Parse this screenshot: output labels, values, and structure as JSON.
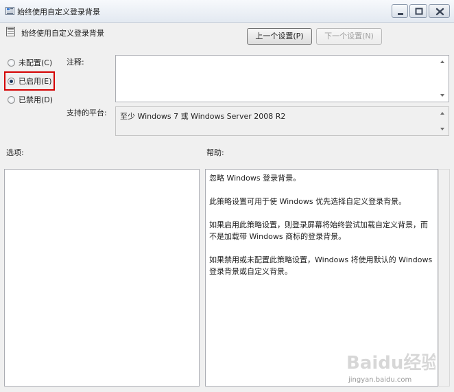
{
  "window": {
    "title": "始终使用自定义登录背景"
  },
  "header": {
    "policy_name": "始终使用自定义登录背景",
    "prev_button": "上一个设置(P)",
    "next_button": "下一个设置(N)"
  },
  "state": {
    "options": [
      {
        "label": "未配置(C)",
        "checked": false
      },
      {
        "label": "已启用(E)",
        "checked": true
      },
      {
        "label": "已禁用(D)",
        "checked": false
      }
    ]
  },
  "comment": {
    "label": "注释:",
    "value": ""
  },
  "platform": {
    "label": "支持的平台:",
    "value": "至少 Windows 7 或 Windows Server 2008 R2"
  },
  "options_panel": {
    "label": "选项:"
  },
  "help_panel": {
    "label": "帮助:",
    "paragraphs": [
      "忽略 Windows 登录背景。",
      "此策略设置可用于使 Windows 优先选择自定义登录背景。",
      "如果启用此策略设置，则登录屏幕将始终尝试加载自定义背景，而不是加载带 Windows 商标的登录背景。",
      "如果禁用或未配置此策略设置，Windows 将使用默认的 Windows 登录背景或自定义背景。"
    ]
  },
  "watermark": {
    "logo": "Baidu经验",
    "url": "jingyan.baidu.com"
  },
  "icons": {
    "app": "policy-settings-icon",
    "policy": "policy-setting-icon"
  }
}
